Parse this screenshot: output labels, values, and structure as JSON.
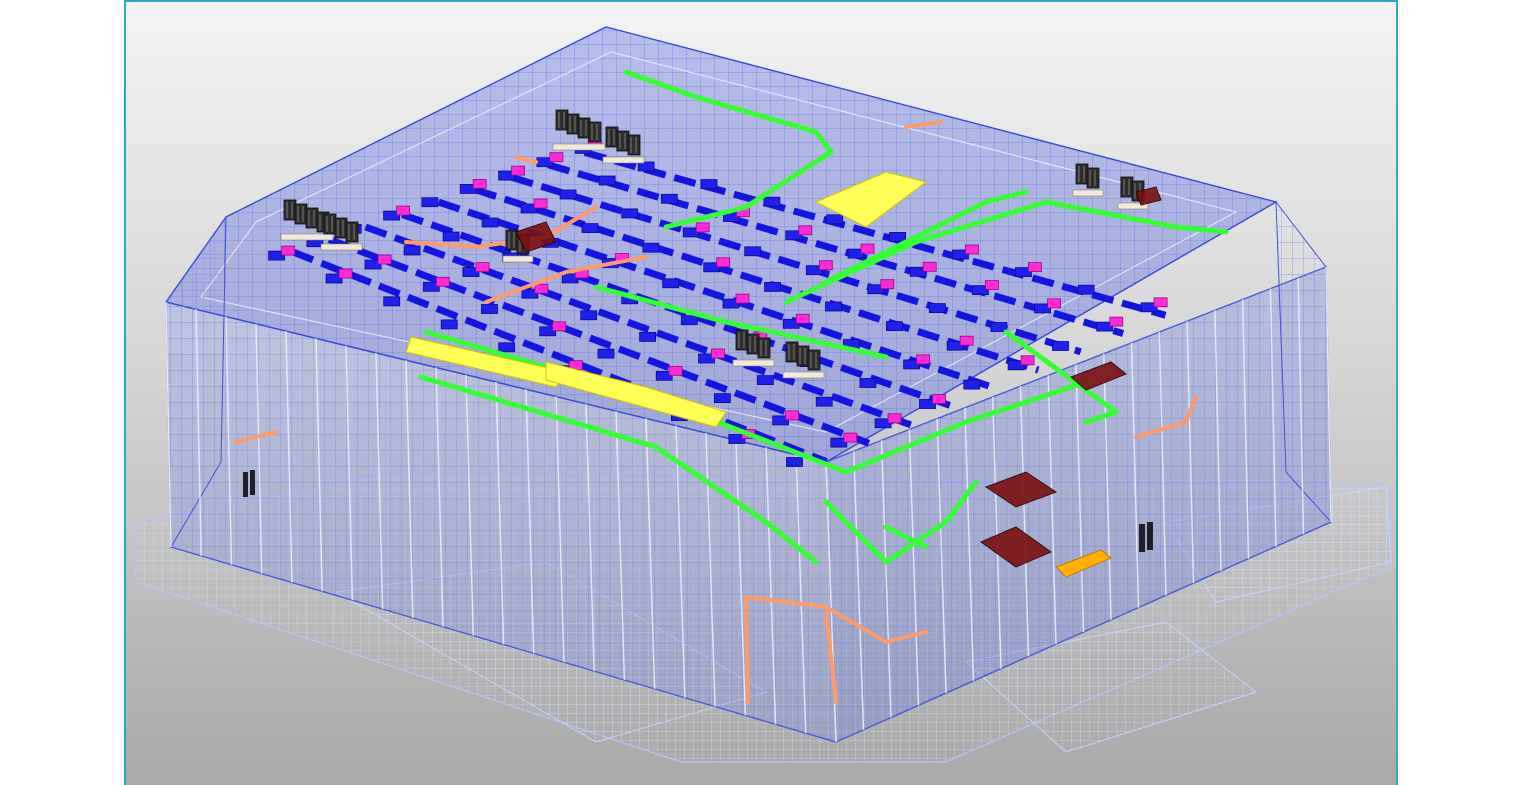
{
  "viewport": {
    "view": "3D isometric",
    "colors": {
      "background_top": "#f3f3f3",
      "background_bottom": "#a9a9a9",
      "frame_border": "#2fa8c8",
      "structure_wireframe": "#4a5ee0",
      "structure_light": "#c9d2ff",
      "ductwork": "#1a1ae6",
      "diffusers": "#ff2bd6",
      "pipework_green": "#33ff33",
      "cable_tray_yellow": "#ffff33",
      "pipework_orange": "#ff9966",
      "equipment_dark": "#2b2b2b",
      "equipment_maroon": "#6b0f0f"
    },
    "elements": [
      "structure-wireframe",
      "ductwork",
      "air-diffusers",
      "green-piping",
      "yellow-cable-tray",
      "orange-piping",
      "rooftop-units",
      "maroon-equipment"
    ]
  }
}
